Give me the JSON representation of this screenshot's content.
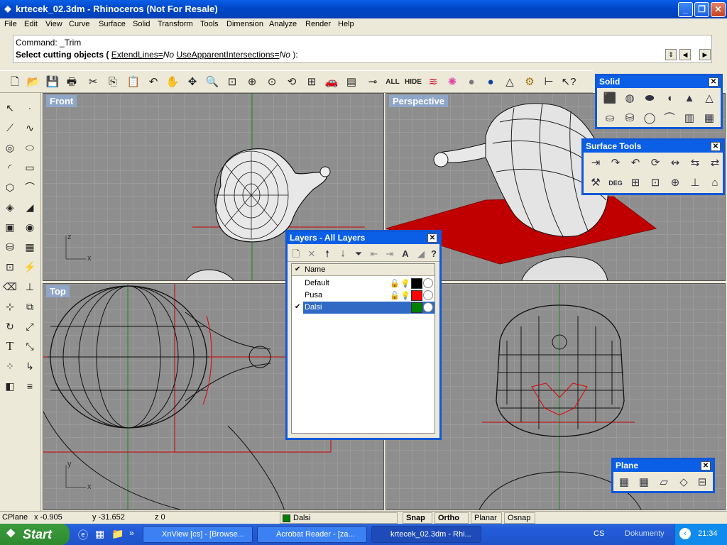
{
  "window": {
    "title": "krtecek_02.3dm - Rhinoceros (Not For Resale)"
  },
  "menu": [
    "File",
    "Edit",
    "View",
    "Curve",
    "Surface",
    "Solid",
    "Transform",
    "Tools",
    "Dimension",
    "Analyze",
    "Render",
    "Help"
  ],
  "command": {
    "line1": "Command: _Trim",
    "line2_prefix": "Select cutting objects ( ",
    "opt1_name": "ExtendLines=",
    "opt1_value": "No",
    "opt2_name": "UseApparentIntersections=",
    "opt2_value": "No",
    "line2_suffix": " ):"
  },
  "toolbar_labels": {
    "all": "ALL",
    "hide": "HIDE",
    "deg": "DEG"
  },
  "viewports": {
    "front": "Front",
    "perspective": "Perspective",
    "top": "Top",
    "axis_x": "x",
    "axis_y": "y",
    "axis_z": "z"
  },
  "panels": {
    "solid": "Solid",
    "surface_tools": "Surface Tools",
    "plane": "Plane"
  },
  "layers": {
    "title": "Layers - All Layers",
    "column_name": "Name",
    "rows": [
      {
        "name": "Default",
        "color": "#000000",
        "current": false
      },
      {
        "name": "Pusa",
        "color": "#FF0000",
        "current": false
      },
      {
        "name": "Dalsi",
        "color": "#008000",
        "current": true
      }
    ],
    "check_mark": "✔"
  },
  "status": {
    "cplane": "CPlane",
    "x": "x -0.905",
    "y": "y -31.652",
    "z": "z 0",
    "layer": "Dalsi",
    "layer_color": "#008000",
    "snap": "Snap",
    "ortho": "Ortho",
    "planar": "Planar",
    "osnap": "Osnap"
  },
  "taskbar": {
    "start": "Start",
    "tasks": [
      "XnView [cs] - [Browse...",
      "Acrobat Reader - [za...",
      "krtecek_02.3dm - Rhi..."
    ],
    "lang": "CS",
    "docs": "Dokumenty",
    "clock": "21:34"
  },
  "colors": {
    "accent": "#0A5FE6",
    "viewport_bg": "#8E8E8E",
    "trim_plane": "#C00000"
  }
}
